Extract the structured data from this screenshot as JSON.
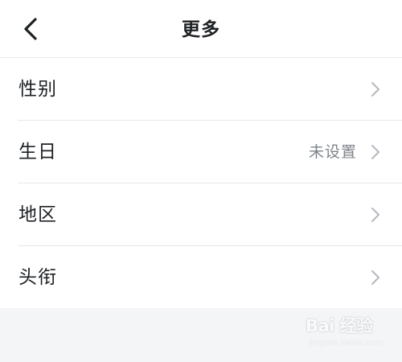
{
  "header": {
    "title": "更多",
    "back_icon": "chevron-left-icon"
  },
  "list": {
    "items": [
      {
        "label": "性别",
        "value": "",
        "icon": "chevron-right-icon"
      },
      {
        "label": "生日",
        "value": "未设置",
        "icon": "chevron-right-icon"
      },
      {
        "label": "地区",
        "value": "",
        "icon": "chevron-right-icon"
      },
      {
        "label": "头衔",
        "value": "",
        "icon": "chevron-right-icon"
      }
    ]
  },
  "watermark": {
    "logo_text": "Bai 经验",
    "url": "jingyan.baidu.com"
  },
  "colors": {
    "background": "#f4f5f7",
    "surface": "#ffffff",
    "text_primary": "#1e2124",
    "text_secondary": "#7d838b",
    "chevron": "#b4b8be",
    "divider": "#e6e7ea"
  }
}
